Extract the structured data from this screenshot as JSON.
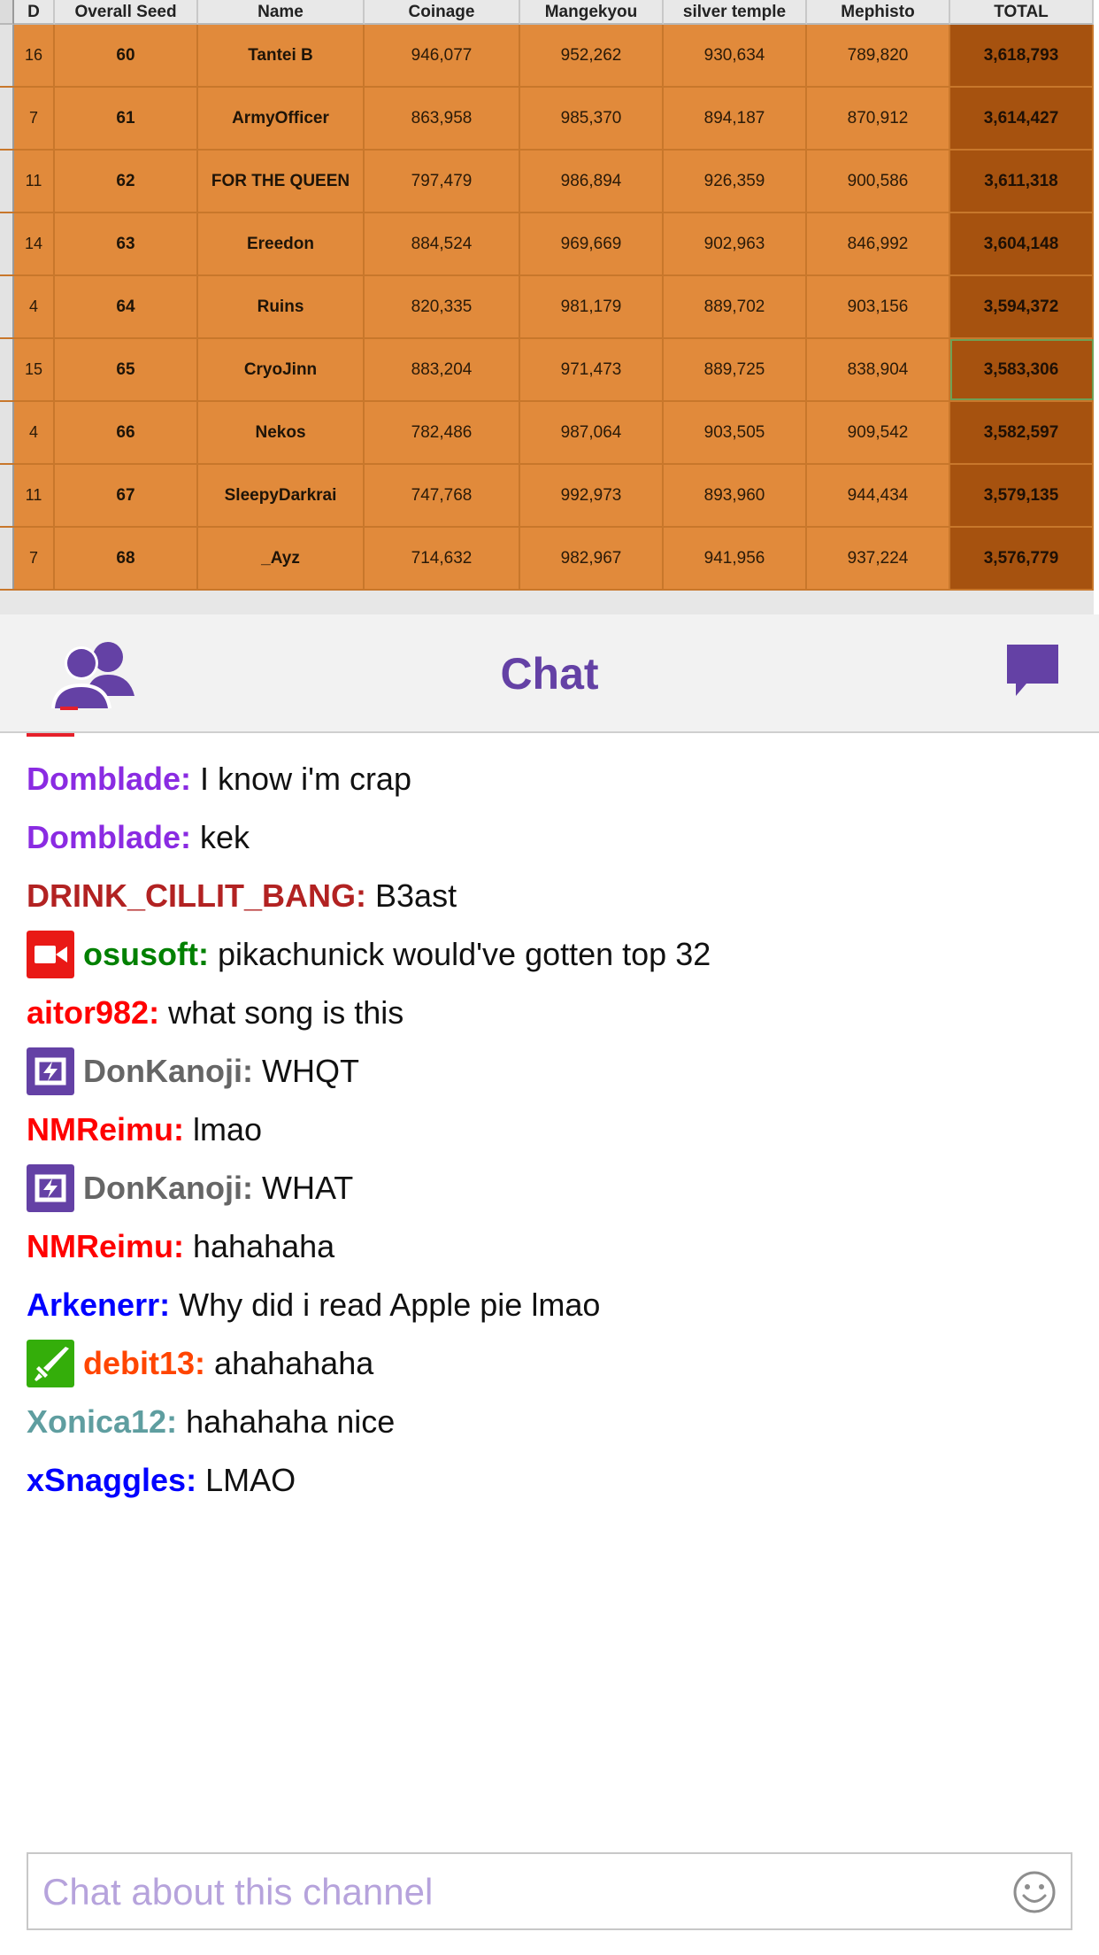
{
  "sheet": {
    "headers": [
      "D",
      "Overall Seed",
      "Name",
      "Coinage",
      "Mangekyou",
      "silver temple",
      "Mephisto",
      "TOTAL"
    ],
    "rows": [
      {
        "d": "16",
        "seed": "60",
        "name": "Tantei B",
        "coinage": "946,077",
        "mangekyou": "952,262",
        "silver_temple": "930,634",
        "mephisto": "789,820",
        "total": "3,618,793"
      },
      {
        "d": "7",
        "seed": "61",
        "name": "ArmyOfficer",
        "coinage": "863,958",
        "mangekyou": "985,370",
        "silver_temple": "894,187",
        "mephisto": "870,912",
        "total": "3,614,427"
      },
      {
        "d": "11",
        "seed": "62",
        "name": "FOR THE QUEEN",
        "coinage": "797,479",
        "mangekyou": "986,894",
        "silver_temple": "926,359",
        "mephisto": "900,586",
        "total": "3,611,318"
      },
      {
        "d": "14",
        "seed": "63",
        "name": "Ereedon",
        "coinage": "884,524",
        "mangekyou": "969,669",
        "silver_temple": "902,963",
        "mephisto": "846,992",
        "total": "3,604,148"
      },
      {
        "d": "4",
        "seed": "64",
        "name": "Ruins",
        "coinage": "820,335",
        "mangekyou": "981,179",
        "silver_temple": "889,702",
        "mephisto": "903,156",
        "total": "3,594,372"
      },
      {
        "d": "15",
        "seed": "65",
        "name": "CryoJinn",
        "coinage": "883,204",
        "mangekyou": "971,473",
        "silver_temple": "889,725",
        "mephisto": "838,904",
        "total": "3,583,306"
      },
      {
        "d": "4",
        "seed": "66",
        "name": "Nekos",
        "coinage": "782,486",
        "mangekyou": "987,064",
        "silver_temple": "903,505",
        "mephisto": "909,542",
        "total": "3,582,597"
      },
      {
        "d": "11",
        "seed": "67",
        "name": "SleepyDarkrai",
        "coinage": "747,768",
        "mangekyou": "992,973",
        "silver_temple": "893,960",
        "mephisto": "944,434",
        "total": "3,579,135"
      },
      {
        "d": "7",
        "seed": "68",
        "name": "_Ayz",
        "coinage": "714,632",
        "mangekyou": "982,967",
        "silver_temple": "941,956",
        "mephisto": "937,224",
        "total": "3,576,779"
      }
    ],
    "selected_row_index": 5,
    "colors": {
      "row_fill": "#e18a3b",
      "total_fill": "#a6520f"
    }
  },
  "chat": {
    "title": "Chat",
    "header_icons": {
      "left": "users-icon",
      "right": "speech-bubble-icon"
    },
    "accent_color": "#6441a5",
    "messages": [
      {
        "user": "Domblade",
        "text": "I know i'm crap",
        "color": "#8a2be2",
        "badge": null
      },
      {
        "user": "Domblade",
        "text": "kek",
        "color": "#8a2be2",
        "badge": null
      },
      {
        "user": "DRINK_CILLIT_BANG",
        "text": "B3ast",
        "color": "#b22222",
        "badge": null
      },
      {
        "user": "osusoft",
        "text": "pikachunick would've gotten top 32",
        "color": "#008000",
        "badge": "broadcaster-camera-icon"
      },
      {
        "user": "aitor982",
        "text": "what song is this",
        "color": "#ff0000",
        "badge": null
      },
      {
        "user": "DonKanoji",
        "text": "WHQT",
        "color": "#666666",
        "badge": "turbo-bolt-icon"
      },
      {
        "user": "NMReimu",
        "text": "lmao",
        "color": "#ff0000",
        "badge": null
      },
      {
        "user": "DonKanoji",
        "text": "WHAT",
        "color": "#666666",
        "badge": "turbo-bolt-icon"
      },
      {
        "user": "NMReimu",
        "text": "hahahaha",
        "color": "#ff0000",
        "badge": null
      },
      {
        "user": "Arkenerr",
        "text": "Why did i read Apple pie lmao",
        "color": "#0000ff",
        "badge": null
      },
      {
        "user": "debit13",
        "text": "ahahahaha",
        "color": "#ff4500",
        "badge": "moderator-sword-icon"
      },
      {
        "user": "Xonica12",
        "text": "hahahaha nice",
        "color": "#5f9ea0",
        "badge": null
      },
      {
        "user": "xSnaggles",
        "text": "LMAO",
        "color": "#0000ff",
        "badge": null
      }
    ],
    "input": {
      "placeholder": "Chat about this channel",
      "value": "",
      "icon": "emoji-smiley-icon"
    }
  }
}
